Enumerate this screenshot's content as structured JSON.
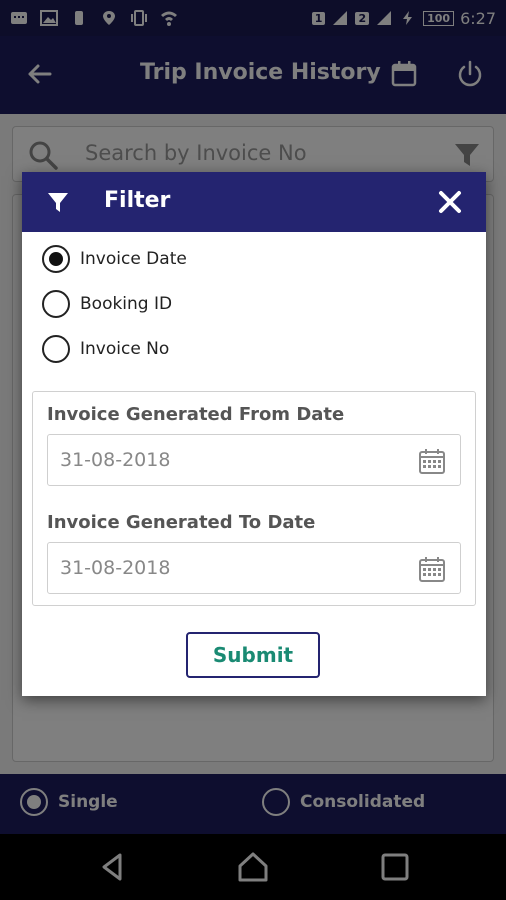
{
  "status_bar": {
    "battery": "100",
    "time": "6:27",
    "sim1": "1",
    "sim2": "2"
  },
  "app_bar": {
    "title": "Trip Invoice History",
    "icons": [
      "back-arrow-icon",
      "calendar-icon",
      "power-icon"
    ]
  },
  "search": {
    "placeholder": "Search by Invoice No"
  },
  "bottom_options": {
    "single_label": "Single",
    "consolidated_label": "Consolidated",
    "selected": "Single"
  },
  "dialog": {
    "title": "Filter",
    "radio_options": [
      {
        "label": "Invoice Date",
        "selected": true
      },
      {
        "label": "Booking ID",
        "selected": false
      },
      {
        "label": "Invoice No",
        "selected": false
      }
    ],
    "from_label": "Invoice Generated From Date",
    "from_value": "31-08-2018",
    "to_label": "Invoice Generated To Date",
    "to_value": "31-08-2018",
    "submit_label": "Submit"
  },
  "colors": {
    "primary_dark": "#1d1d5e",
    "dialog_header": "#242470",
    "submit_text": "#1a8a73"
  }
}
